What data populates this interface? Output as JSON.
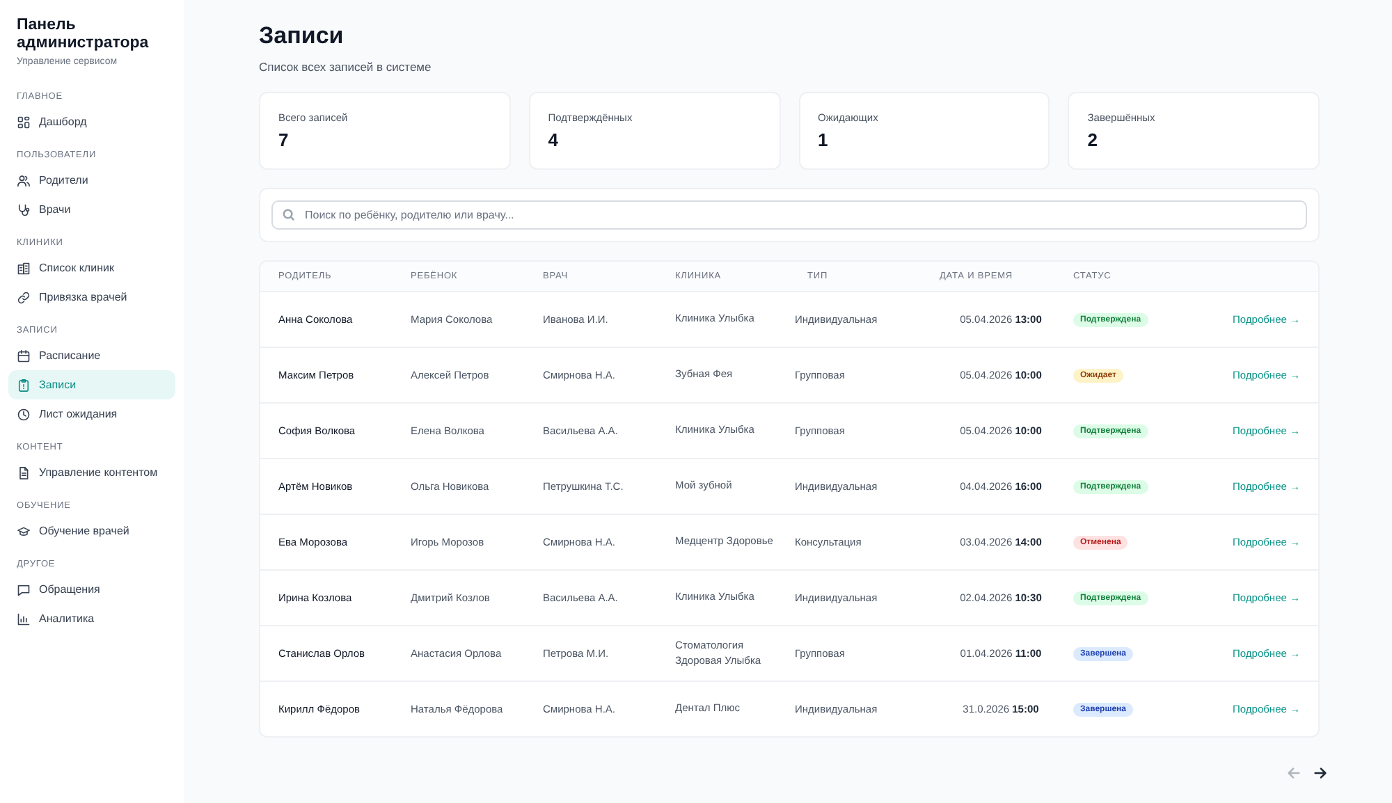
{
  "sidebar": {
    "title": "Панель администратора",
    "subtitle": "Управление сервисом",
    "sections": [
      {
        "heading": "ГЛАВНОЕ",
        "items": [
          {
            "label": "Дашборд",
            "selected": false
          }
        ]
      },
      {
        "heading": "ПОЛЬЗОВАТЕЛИ",
        "items": [
          {
            "label": "Родители",
            "selected": false
          },
          {
            "label": "Врачи",
            "selected": false
          }
        ]
      },
      {
        "heading": "КЛИНИКИ",
        "items": [
          {
            "label": "Список клиник",
            "selected": false
          },
          {
            "label": "Привязка врачей",
            "selected": false
          }
        ]
      },
      {
        "heading": "ЗАПИСИ",
        "items": [
          {
            "label": "Расписание",
            "selected": false
          },
          {
            "label": "Записи",
            "selected": true
          },
          {
            "label": "Лист ожидания",
            "selected": false
          }
        ]
      },
      {
        "heading": "КОНТЕНТ",
        "items": [
          {
            "label": "Управление контентом",
            "selected": false
          }
        ]
      },
      {
        "heading": "ОБУЧЕНИЕ",
        "items": [
          {
            "label": "Обучение врачей",
            "selected": false
          }
        ]
      },
      {
        "heading": "ДРУГОЕ",
        "items": [
          {
            "label": "Обращения",
            "selected": false
          },
          {
            "label": "Аналитика",
            "selected": false
          }
        ]
      }
    ]
  },
  "page": {
    "title": "Записи",
    "subtitle": "Список всех записей в системе"
  },
  "stats": [
    {
      "label": "Всего записей",
      "value": "7"
    },
    {
      "label": "Подтверждённых",
      "value": "4"
    },
    {
      "label": "Ожидающих",
      "value": "1"
    },
    {
      "label": "Завершённых",
      "value": "2"
    }
  ],
  "search": {
    "placeholder": "Поиск по ребёнку, родителю или врачу..."
  },
  "table": {
    "columns": [
      "РОДИТЕЛЬ",
      "РЕБЁНОК",
      "ВРАЧ",
      "КЛИНИКА",
      "ТИП",
      "ДАТА И ВРЕМЯ",
      "СТАТУС"
    ],
    "rows": [
      {
        "parent": "Анна Соколова",
        "child": "Мария Соколова",
        "doctor": "Иванова И.И.",
        "clinic": "Клиника Улыбка",
        "type": "Индивидуальная",
        "datetime": "05.04.2026 **13:00**",
        "status": {
          "label": "Подтверждена",
          "kind": "confirmed"
        },
        "link": "Подробнее →"
      },
      {
        "parent": "Максим Петров",
        "child": "Алексей Петров",
        "doctor": "Смирнова Н.А.",
        "clinic": "Зубная Фея",
        "type": "Групповая",
        "datetime": "05.04.2026 **10:00**",
        "status": {
          "label": "Ожидает",
          "kind": "pending"
        },
        "link": "Подробнее →"
      },
      {
        "parent": "София Волкова",
        "child": "Елена Волкова",
        "doctor": "Васильева А.А.",
        "clinic": "Клиника Улыбка",
        "type": "Групповая",
        "datetime": "05.04.2026 **10:00**",
        "status": {
          "label": "Подтверждена",
          "kind": "confirmed"
        },
        "link": "Подробнее →"
      },
      {
        "parent": "Артём Новиков",
        "child": "Ольга Новикова",
        "doctor": "Петрушкина Т.С.",
        "clinic": "Мой зубной",
        "type": "Индивидуальная",
        "datetime": "04.04.2026 **16:00**",
        "status": {
          "label": "Подтверждена",
          "kind": "confirmed"
        },
        "link": "Подробнее →"
      },
      {
        "parent": "Ева Морозова",
        "child": "Игорь Морозов",
        "doctor": "Смирнова Н.А.",
        "clinic": "Медцентр Здоровье",
        "type": "Консультация",
        "datetime": "03.04.2026 **14:00**",
        "status": {
          "label": "Отменена",
          "kind": "cancelled"
        },
        "link": "Подробнее →"
      },
      {
        "parent": "Ирина Козлова",
        "child": "Дмитрий Козлов",
        "doctor": "Васильева А.А.",
        "clinic": "Клиника Улыбка",
        "type": "Индивидуальная",
        "datetime": "02.04.2026 **10:30**",
        "status": {
          "label": "Подтверждена",
          "kind": "confirmed"
        },
        "link": "Подробнее →"
      },
      {
        "parent": "Станислав Орлов",
        "child": "Анастасия Орлова",
        "doctor": "Петрова М.И.",
        "clinic": "Стоматология Здоровая Улыбка",
        "type": "Групповая",
        "datetime": "01.04.2026 **11:00**",
        "status": {
          "label": "Завершена",
          "kind": "done"
        },
        "link": "Подробнее →"
      },
      {
        "parent": "Кирилл Фёдоров",
        "child": "Наталья Фёдорова",
        "doctor": "Смирнова Н.А.",
        "clinic": "Дентал Плюс",
        "type": "Индивидуальная",
        "datetime": "31.0.2026 **15:00**",
        "status": {
          "label": "Завершена",
          "kind": "done"
        },
        "link": "Подробнее →"
      }
    ]
  },
  "pagination": {
    "prev_disabled": true,
    "next_disabled": false
  }
}
